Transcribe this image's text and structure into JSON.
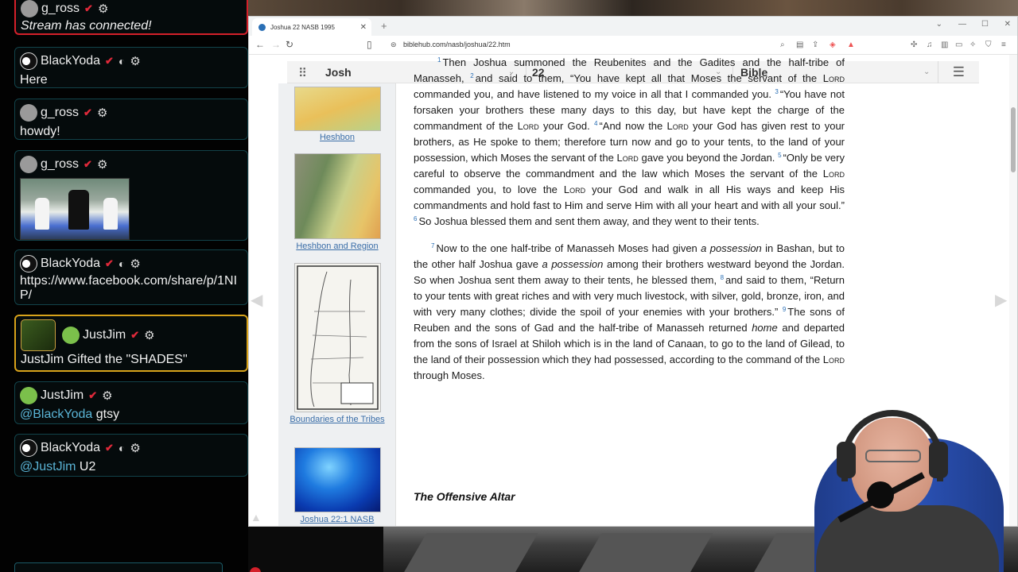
{
  "chat": {
    "messages": [
      {
        "user": "g_ross",
        "text": "Stream has connected!",
        "style": "italic"
      },
      {
        "user": "BlackYoda",
        "text": "Here"
      },
      {
        "user": "g_ross",
        "text": "howdy!"
      },
      {
        "user": "g_ross",
        "text": ""
      },
      {
        "user": "BlackYoda",
        "text_line1": "https://www.facebook.com/share/p/1NI",
        "text_line2": "P/"
      },
      {
        "user": "JustJim",
        "text": "JustJim Gifted the \"SHADES\""
      },
      {
        "user": "JustJim",
        "mention": "@BlackYoda",
        "text": "gtsy"
      },
      {
        "user": "BlackYoda",
        "mention": "@JustJim",
        "text": "U2"
      }
    ]
  },
  "browser": {
    "tab_title": "Joshua 22 NASB 1995",
    "url": "biblehub.com/nasb/joshua/22.htm"
  },
  "page": {
    "book_select": "Josh",
    "chapter_select": "22",
    "version_select": "Bible",
    "sidebar": {
      "captions": [
        "Heshbon",
        "Heshbon and Region",
        "Boundaries of the Tribes",
        "Joshua 22:1 NASB"
      ]
    },
    "lord": "Lord",
    "para1": {
      "v1": "Then Joshua summoned the Reubenites and the Gadites and the half-tribe of Manasseh,",
      "v2a": "and said to them, “You have kept all that Moses the servant of the",
      "v2b": "commanded you, and have listened to my voice in all that I commanded you.",
      "v3a": "“You have not forsaken your brothers these many days to this day, but have kept the charge of the commandment of the",
      "v3b": "your God.",
      "v4a": "“And now the",
      "v4b": "your God has given rest to your brothers, as He spoke to them; therefore turn now and go to your tents, to the land of your possession, which Moses the servant of the",
      "v4c": "gave you beyond the Jordan.",
      "v5a": "“Only be very careful to observe the commandment and the law which Moses the servant of the",
      "v5b": "commanded you, to love the",
      "v5c": "your God and walk in all His ways and keep His commandments and hold fast to Him and serve Him with all your heart and with all your soul.”",
      "v6": "So Joshua blessed them and sent them away, and they went to their tents."
    },
    "para2": {
      "v7a": "Now to the one half-tribe of Manasseh Moses had given",
      "v7i1": "a possession",
      "v7b": "in Bashan, but to the other half Joshua gave",
      "v7i2": "a possession",
      "v7c": "among their brothers westward beyond the Jordan. So when Joshua sent them away to their tents, he blessed them,",
      "v8": "and said to them, “Return to your tents with great riches and with very much livestock, with silver, gold, bronze, iron, and with very many clothes; divide the spoil of your enemies with your brothers.”",
      "v9a": "The sons of Reuben and the sons of Gad and the half-tribe of Manasseh returned",
      "v9i": "home",
      "v9b": "and departed from the sons of Israel at Shiloh which is in the land of Canaan, to go to the land of Gilead, to the land of their possession which they had possessed, according to the command of the",
      "v9c": "through Moses."
    },
    "heading": "The Offensive Altar"
  },
  "colors": {
    "link": "#3b6ea8",
    "verse_number": "#2a6fb5",
    "chat_mention": "#5ab4d6",
    "chat_highlight_red": "#d4202a",
    "chat_highlight_gold": "#d8a21a"
  }
}
